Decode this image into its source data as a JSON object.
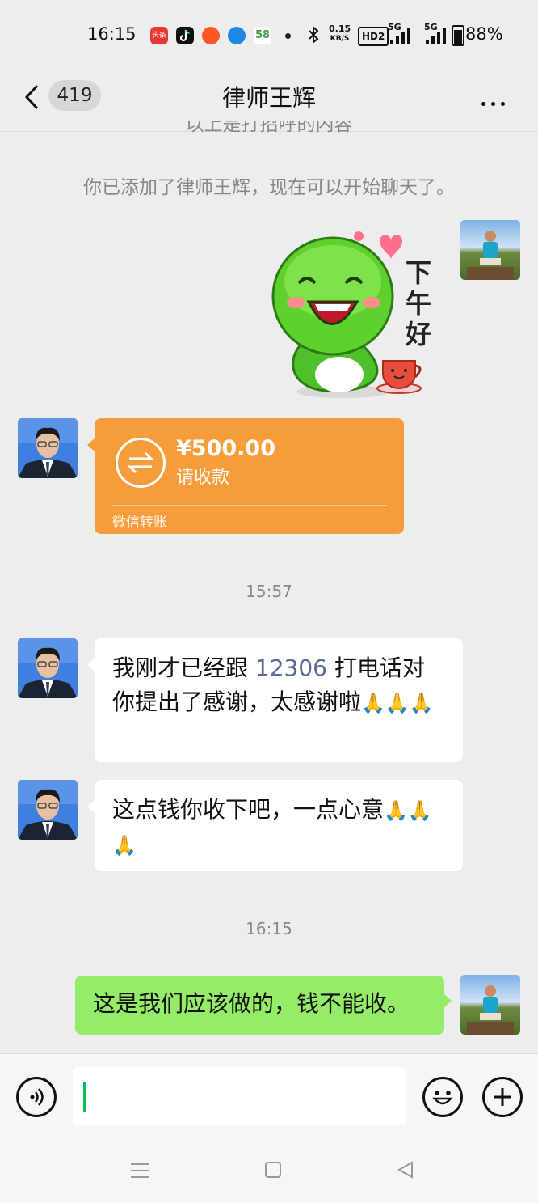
{
  "status_bar": {
    "time": "16:15",
    "net_rate_value": "0.15",
    "net_rate_unit": "KB/S",
    "hd_badge": "HD2",
    "signal_1": "5G",
    "signal_2": "5G",
    "battery": "88%",
    "app_icons": [
      "toutiao-icon",
      "douyin-icon",
      "taobao-icon",
      "blue-app-icon",
      "58-icon"
    ],
    "label_58": "58",
    "label_toutiao": "头条",
    "icons": [
      "bluetooth-icon",
      "battery-icon"
    ]
  },
  "header": {
    "unread_count": "419",
    "title": "律师王辉",
    "more_icon": "more-icon"
  },
  "messages": {
    "partial_system": "以上是打招呼的内容",
    "system_added": "你已添加了律师王辉，现在可以开始聊天了。",
    "sticker": {
      "caption": "下午好"
    },
    "transfer": {
      "amount": "¥500.00",
      "label": "请收款",
      "footer": "微信转账"
    },
    "timestamp_1": "15:57",
    "msg1": {
      "text_a": "我刚才已经跟 ",
      "link": "12306",
      "text_b": " 打电话对你提出了感谢，太感谢啦"
    },
    "msg2": {
      "text": "这点钱你收下吧，一点心意"
    },
    "timestamp_2": "16:15",
    "msg3": {
      "text": "这是我们应该做的，钱不能收。"
    }
  },
  "input_bar": {
    "voice_icon": "voice-icon",
    "emoji_icon": "emoji-icon",
    "plus_icon": "plus-icon"
  },
  "nav": {
    "icons": [
      "menu-icon",
      "home-icon",
      "back-icon"
    ]
  },
  "colors": {
    "bubble_green": "#95ec69",
    "transfer_orange": "#f79c3b",
    "link_blue": "#576b95",
    "background": "#ededed"
  }
}
